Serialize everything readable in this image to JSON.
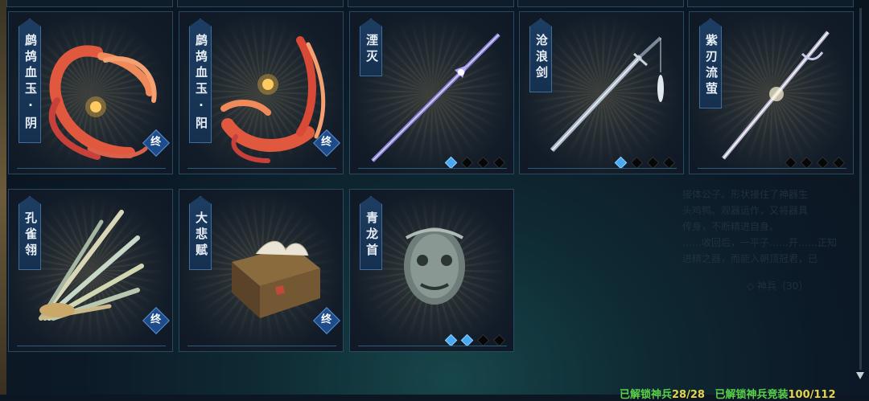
{
  "cards": [
    {
      "id": "zhegu-yin",
      "name": "鹧鸪血玉·阴",
      "badge": "终",
      "gems": []
    },
    {
      "id": "zhegu-yang",
      "name": "鹧鸪血玉·阳",
      "badge": "终",
      "gems": []
    },
    {
      "id": "yanmie",
      "name": "湮灭",
      "badge": "",
      "gems": [
        true,
        false,
        false,
        false
      ]
    },
    {
      "id": "canglang",
      "name": "沧浪剑",
      "badge": "",
      "gems": [
        true,
        false,
        false,
        false
      ]
    },
    {
      "id": "zirenliuying",
      "name": "紫刃流萤",
      "badge": "",
      "gems": [
        false,
        false,
        false,
        false
      ]
    },
    {
      "id": "kongquelin",
      "name": "孔雀翎",
      "badge": "终",
      "gems": []
    },
    {
      "id": "dabeifu",
      "name": "大悲赋",
      "badge": "终",
      "gems": []
    },
    {
      "id": "qinglongshou",
      "name": "青龙首",
      "badge": "",
      "gems": [
        true,
        true,
        false,
        false
      ]
    }
  ],
  "description": {
    "lines": [
      "接体公子。形状接住了神器生",
      "头鸡鸭。观器运作，又将器具",
      "传身，不断精进自身。",
      "……收回后，一平子……开……正知",
      "进精之器，而能入朝顶冠君，已"
    ],
    "footnote": "◇ 神兵（30）"
  },
  "footer": {
    "unlocked_label": "已解锁神兵",
    "unlocked_value": "28/28",
    "appearance_label": "已解锁神兵竞装",
    "appearance_value": "100/112"
  },
  "colors": {
    "gem_on": "#4aa8f0",
    "badge": "#1e4c8a",
    "footer_green": "#5bd24a",
    "footer_yellow": "#e7d34a"
  }
}
